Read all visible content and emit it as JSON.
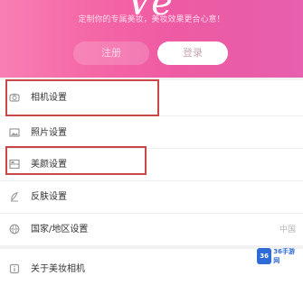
{
  "header": {
    "logo_text": "Ve",
    "slogan": "定制你的专属美妆，美妆效果更合心意！",
    "register_label": "注册",
    "login_label": "登录",
    "gradient_start": "#f87fb4",
    "gradient_end": "#e85fb0"
  },
  "menu": {
    "items": [
      {
        "label": "相机设置",
        "icon": "camera-icon",
        "right": ""
      },
      {
        "label": "照片设置",
        "icon": "photo-icon",
        "right": ""
      },
      {
        "label": "美颜设置",
        "icon": "beauty-icon",
        "right": ""
      },
      {
        "label": "反肤设置",
        "icon": "skin-icon",
        "right": ""
      },
      {
        "label": "国家/地区设置",
        "icon": "globe-icon",
        "right": "中国"
      },
      {
        "label": "关于美妆相机",
        "icon": "info-icon",
        "right": ""
      }
    ]
  },
  "watermark": {
    "badge": "36",
    "text": "36手游网"
  },
  "colors": {
    "highlight": "#c94747",
    "accent": "#ef5ba4"
  }
}
